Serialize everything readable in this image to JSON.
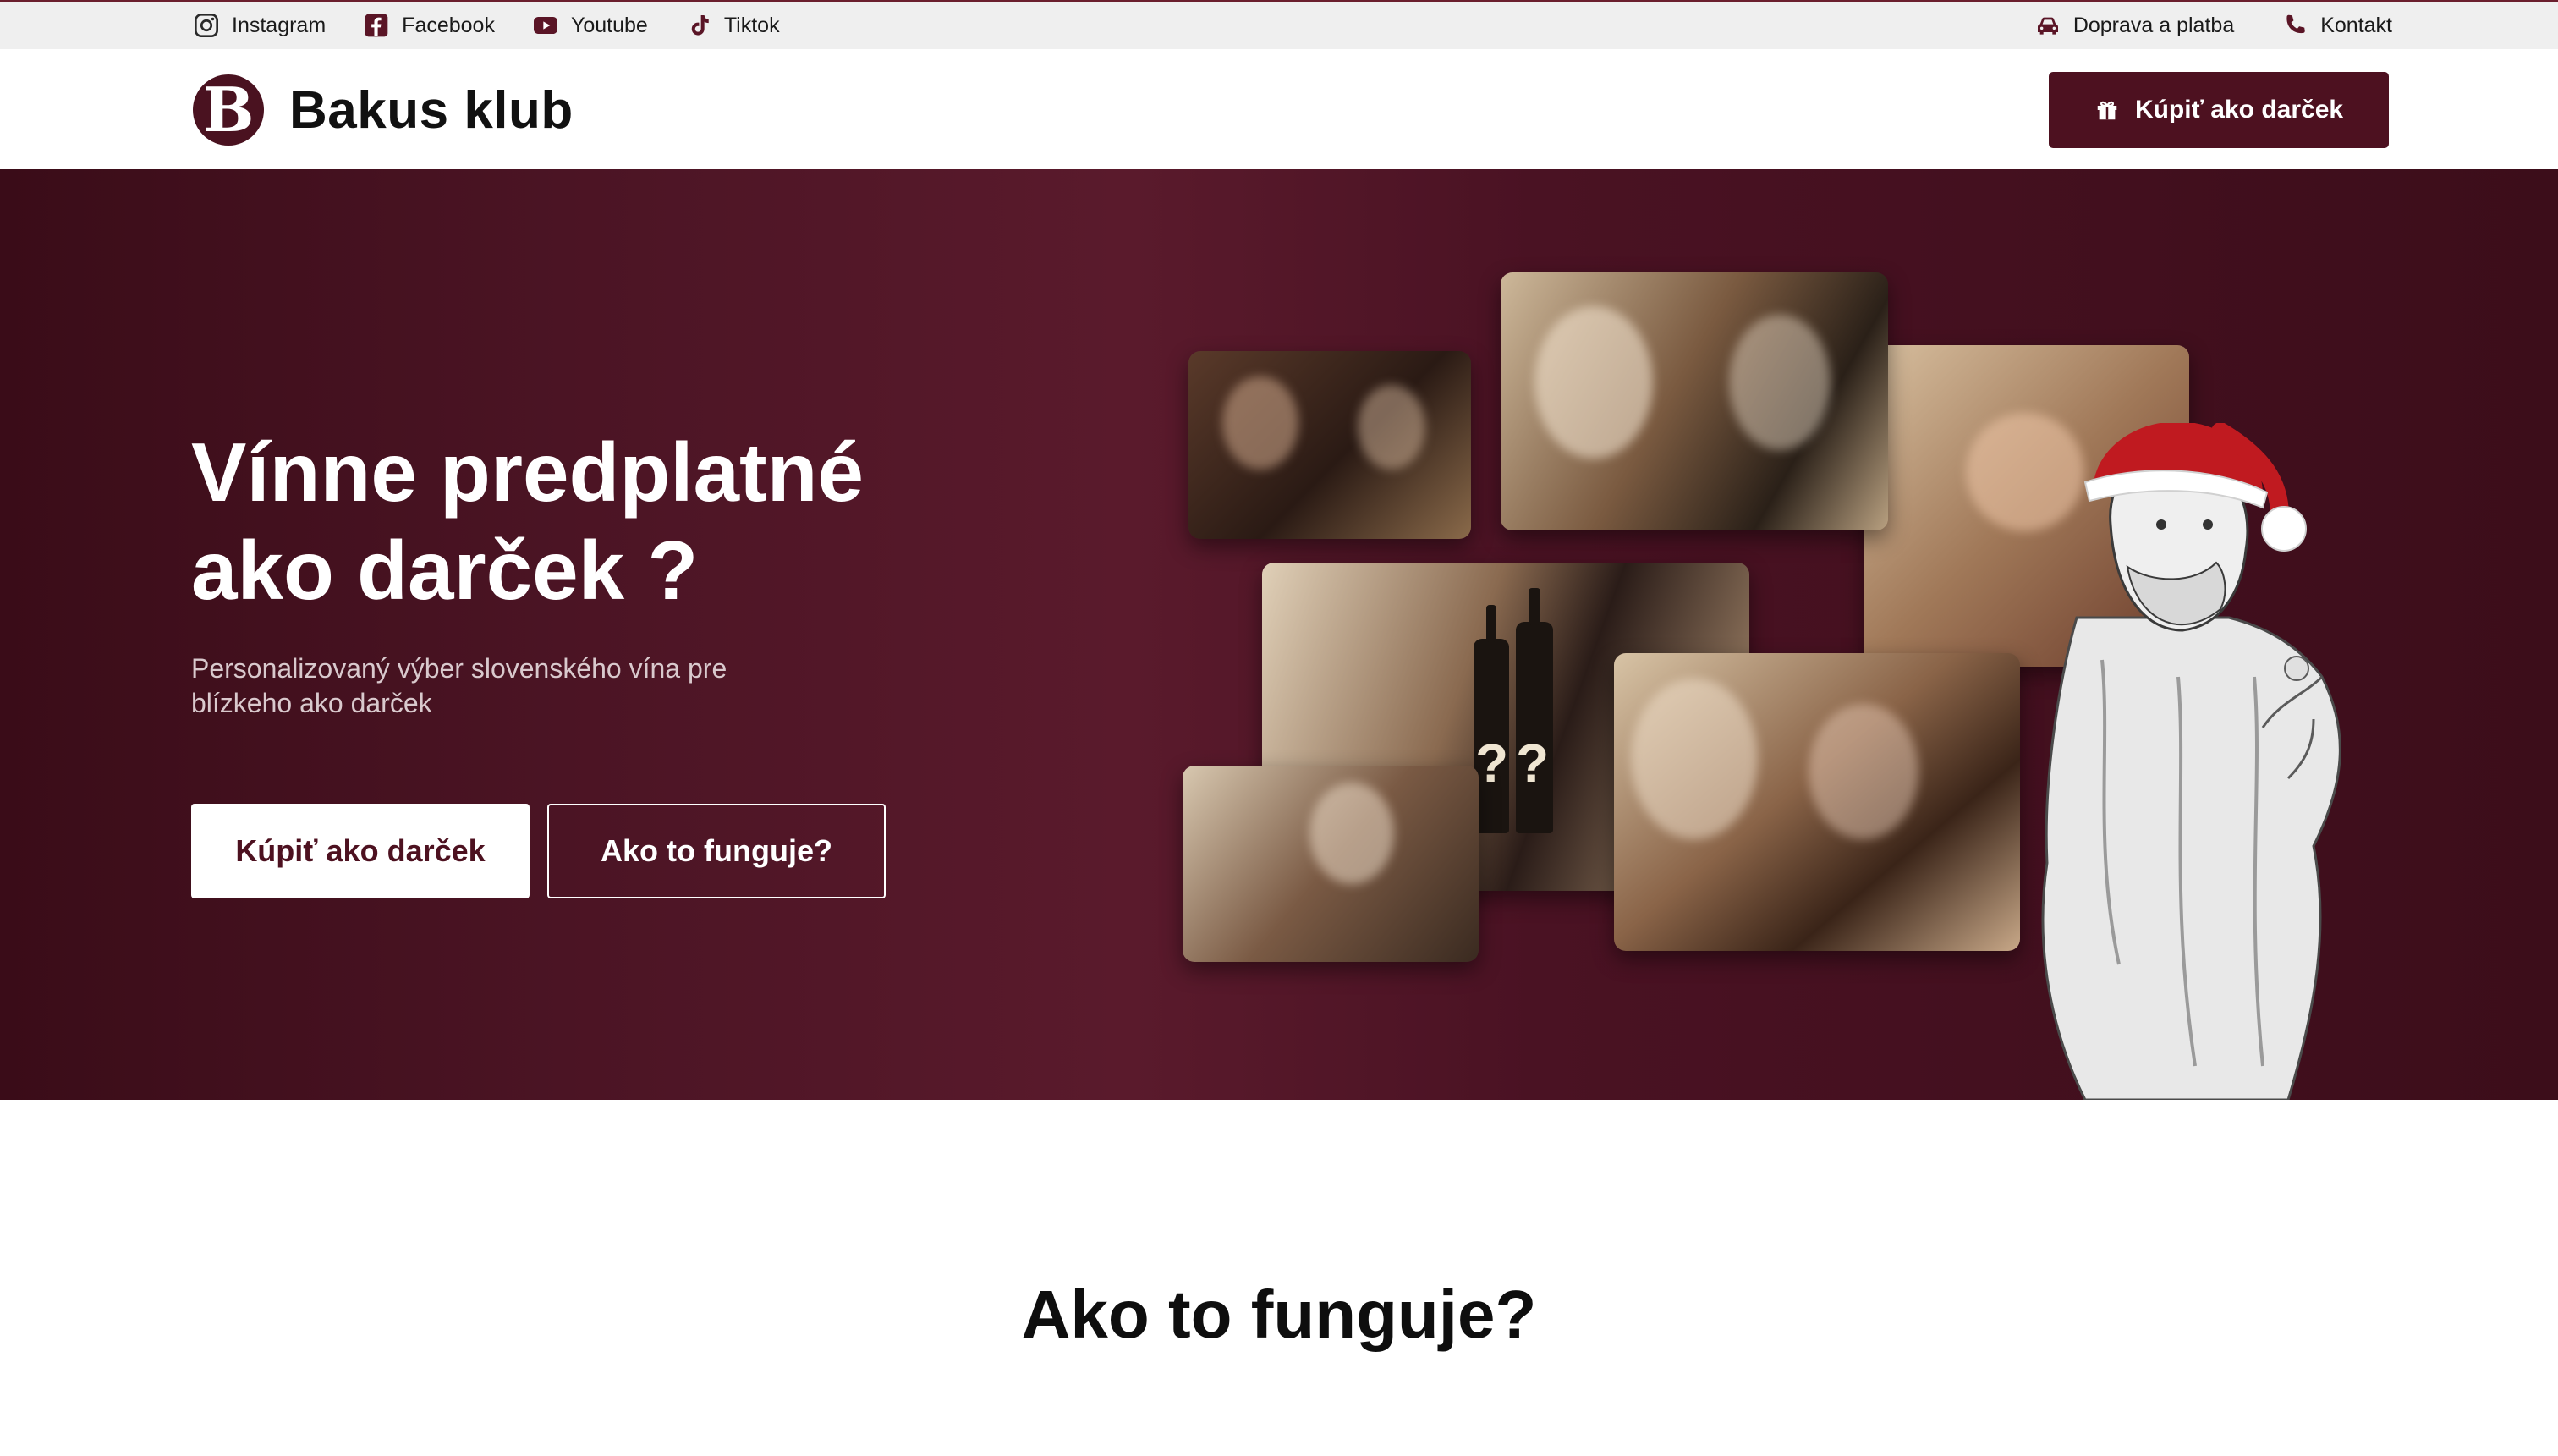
{
  "topbar": {
    "social": [
      {
        "label": "Instagram",
        "icon": "instagram-icon"
      },
      {
        "label": "Facebook",
        "icon": "facebook-icon"
      },
      {
        "label": "Youtube",
        "icon": "youtube-icon"
      },
      {
        "label": "Tiktok",
        "icon": "tiktok-icon"
      }
    ],
    "shipping_label": "Doprava a platba",
    "contact_label": "Kontakt"
  },
  "header": {
    "logo_letter": "B",
    "brand_name": "Bakus klub",
    "cta_label": "Kúpiť ako darček"
  },
  "hero": {
    "title_line1": "Vínne predplatné",
    "title_line2": "ako darček ?",
    "subtitle": "Personalizovaný výber slovenského vína pre blízkeho ako darček",
    "primary_button": "Kúpiť ako darček",
    "secondary_button": "Ako to funguje?"
  },
  "how_it_works": {
    "title": "Ako to funguje?"
  },
  "colors": {
    "brand": "#4d1120",
    "hero_background": "#4b1424",
    "topbar_background": "#efefef"
  }
}
